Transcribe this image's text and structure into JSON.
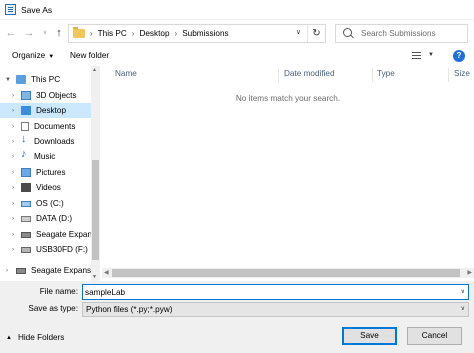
{
  "window": {
    "title": "Save As"
  },
  "address": {
    "crumbs": [
      "This PC",
      "Desktop",
      "Submissions"
    ],
    "search_placeholder": "Search Submissions"
  },
  "toolbar": {
    "organize_label": "Organize",
    "new_folder_label": "New folder"
  },
  "nav": {
    "items": [
      {
        "label": "This PC",
        "icon": "pc-icon"
      },
      {
        "label": "3D Objects",
        "icon": "3d-objects-icon"
      },
      {
        "label": "Desktop",
        "icon": "desktop-icon",
        "selected": true
      },
      {
        "label": "Documents",
        "icon": "documents-icon"
      },
      {
        "label": "Downloads",
        "icon": "downloads-icon"
      },
      {
        "label": "Music",
        "icon": "music-icon"
      },
      {
        "label": "Pictures",
        "icon": "pictures-icon"
      },
      {
        "label": "Videos",
        "icon": "videos-icon"
      },
      {
        "label": "OS (C:)",
        "icon": "os-drive-icon"
      },
      {
        "label": "DATA (D:)",
        "icon": "drive-icon"
      },
      {
        "label": "Seagate Expansio",
        "icon": "external-drive-icon"
      },
      {
        "label": "USB30FD (F:)",
        "icon": "usb-drive-icon"
      },
      {
        "label": "Seagate Expansion",
        "icon": "external-drive-icon"
      }
    ]
  },
  "columns": {
    "name": "Name",
    "date_modified": "Date modified",
    "type": "Type",
    "size": "Size"
  },
  "content": {
    "empty_message": "No items match your search."
  },
  "form": {
    "file_name_label": "File name:",
    "file_name_value": "sampleLab",
    "save_type_label": "Save as type:",
    "save_type_value": "Python files (*.py;*.pyw)"
  },
  "footer": {
    "hide_folders_label": "Hide Folders",
    "save_label": "Save",
    "cancel_label": "Cancel"
  },
  "colors": {
    "accent": "#0078d7",
    "selected_bg": "#cce8ff",
    "panel_bg": "#f0f0f0"
  }
}
